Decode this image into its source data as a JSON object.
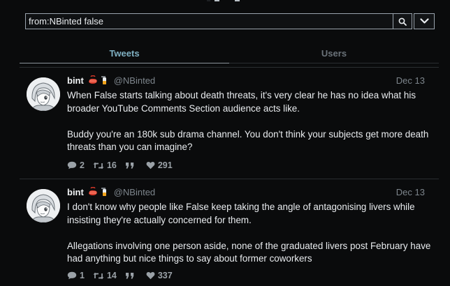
{
  "search": {
    "query": "from:NBinted false"
  },
  "tabs": [
    {
      "label": "Tweets",
      "active": true
    },
    {
      "label": "Users",
      "active": false
    }
  ],
  "tweets": [
    {
      "display_name": "bint",
      "emojis": [
        "spouting-whale-icon",
        "fire-extinguisher-icon"
      ],
      "handle": "@NBinted",
      "date": "Dec 13",
      "text": "When False starts talking about death threats, it's very clear he has no idea what his broader YouTube Comments Section audience acts like.\n\nBuddy you're an 180k sub drama channel. You don't think your subjects get more death threats than you can imagine?",
      "replies": "2",
      "retweets": "16",
      "likes": "291"
    },
    {
      "display_name": "bint",
      "emojis": [
        "spouting-whale-icon",
        "fire-extinguisher-icon"
      ],
      "handle": "@NBinted",
      "date": "Dec 13",
      "text": "I don't know why people like False keep taking the angle of antagonising livers while insisting they're actually concerned for them.\n\nAllegations involving one person aside, none of the graduated livers post February have had anything but nice things to say about former coworkers",
      "replies": "1",
      "retweets": "14",
      "likes": "337"
    }
  ],
  "colors": {
    "background": "#0a0b0c",
    "active_tab": "#7fb0c2",
    "inactive_tab": "#6b737a",
    "muted_text": "#7d858c",
    "action_icon": "#9aa1a7"
  }
}
